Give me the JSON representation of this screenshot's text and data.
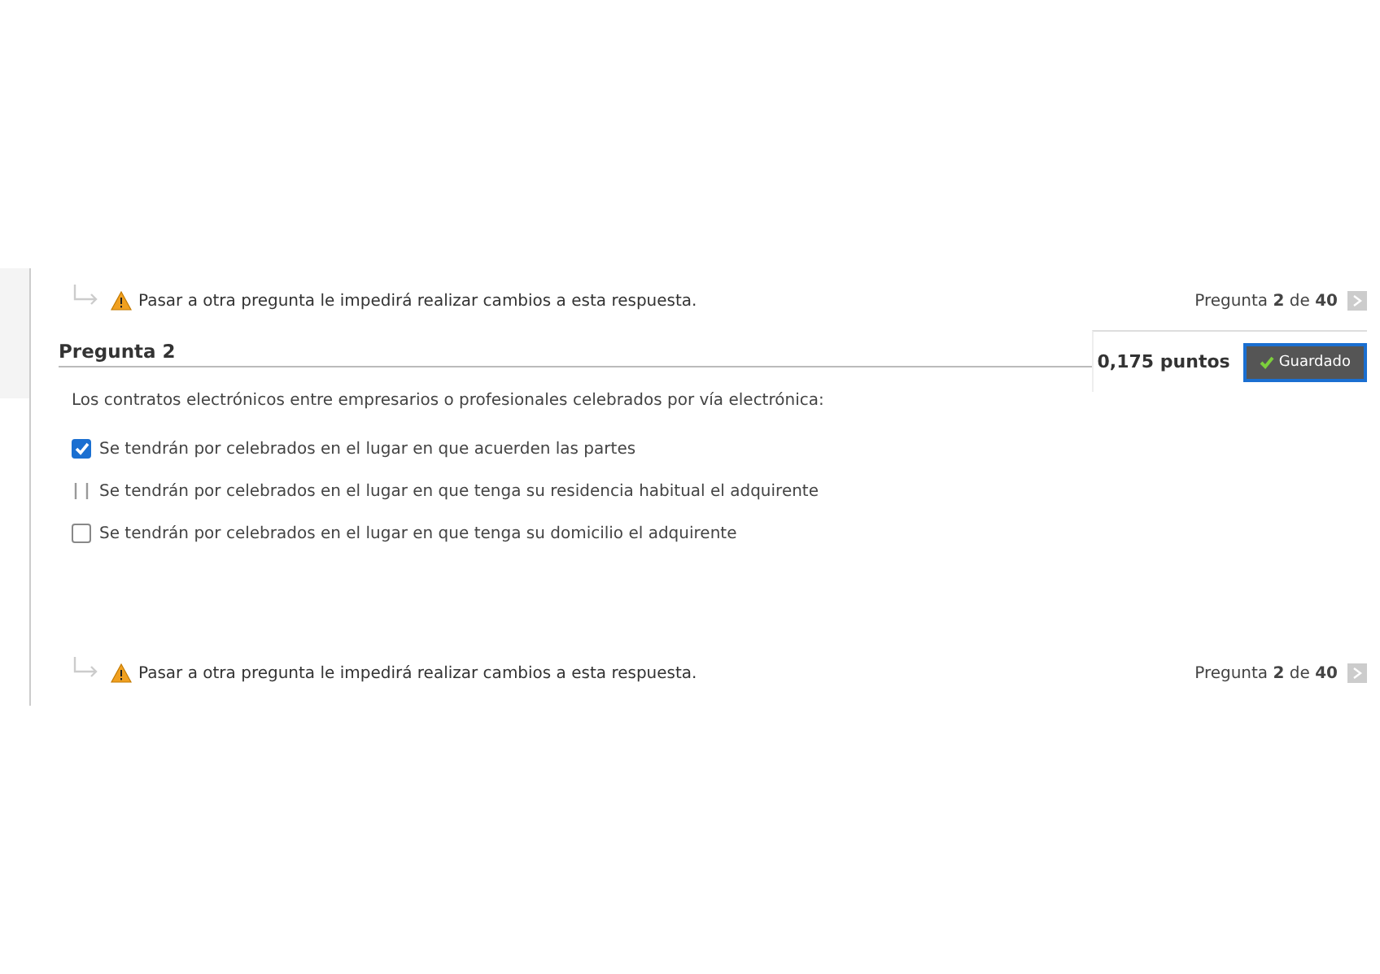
{
  "top_notice": {
    "text": "Pasar a otra pregunta le impedirá realizar cambios a esta respuesta.",
    "pager": "Pregunta **2** de **40**"
  },
  "question": {
    "title": "Pregunta 2",
    "points": "0,175 puntos",
    "status": "Guardado",
    "prompt": "Los contratos electrónicos entre empresarios o profesionales celebrados por vía electrónica:",
    "options": [
      {
        "kind": "checkbox",
        "text": "Se tendrán por celebrados en el lugar en que acuerden las partes",
        "checked": true
      },
      {
        "kind": "brackets",
        "text": "Se tendrán por celebrados en el lugar en que tenga su residencia habitual el adquirente",
        "checked": false
      },
      {
        "kind": "checkbox",
        "text": "Se tendrán por celebrados en el lugar en que tenga su domicilio el adquirente",
        "checked": false
      }
    ]
  },
  "bottom_notice": {
    "text": "Pasar a otra pregunta le impedirá realizar cambios a esta respuesta.",
    "pager": "Pregunta **2** de **40**"
  }
}
